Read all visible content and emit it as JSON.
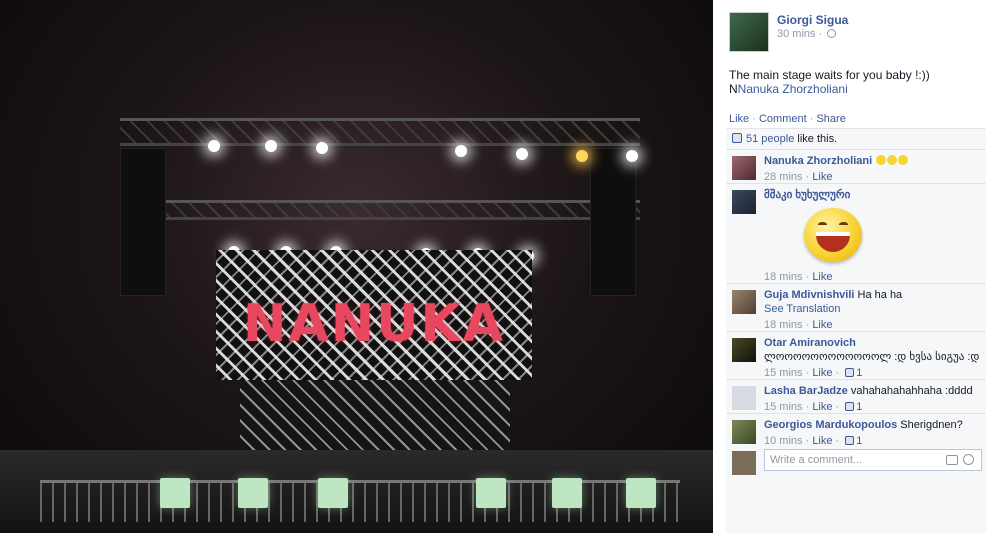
{
  "photo": {
    "stage_text": "NANUKA"
  },
  "post": {
    "author": "Giorgi Sigua",
    "avatar_caption": "",
    "time": "30 mins ·",
    "caption_line1": "The main stage waits for you baby !:))",
    "caption_prefix": "N",
    "caption_tag": "Nanuka Zhorzholiani",
    "actions": {
      "like": "Like",
      "comment": "Comment",
      "share": "Share",
      "sep": "·"
    },
    "likes_count": "51 people",
    "likes_suffix": "like this."
  },
  "comments": [
    {
      "name": "Nanuka Zhorzholiani",
      "text": "",
      "has_emojis": true,
      "time": "28 mins",
      "action": "Like",
      "likes": ""
    },
    {
      "name": "მშაკი ხუხულური",
      "text": "",
      "has_sticker": true,
      "time": "18 mins",
      "action": "Like",
      "likes": ""
    },
    {
      "name": "Guja Mdivnishvili",
      "text": "Ha ha ha",
      "translation": "See Translation",
      "time": "18 mins",
      "action": "Like",
      "likes": ""
    },
    {
      "name": "Otar Amiranovich",
      "text": "ლოოოოოოოოოოოოლ :დ ხვსა სიგუა :დ",
      "time": "15 mins",
      "action": "Like",
      "likes": "1"
    },
    {
      "name": "Lasha BarJadze",
      "text": "vahahahahahhaha :dddd",
      "time": "15 mins",
      "action": "Like",
      "likes": "1"
    },
    {
      "name": "Georgios Mardukopoulos",
      "text": "Sherigdnen?",
      "time": "10 mins",
      "action": "Like",
      "likes": "1"
    }
  ],
  "composer": {
    "placeholder": "Write a comment..."
  },
  "icons": {
    "globe": "globe-icon",
    "thumb": "thumbs-up-icon",
    "camera": "camera-icon",
    "emoji": "emoticon-icon"
  },
  "colors": {
    "link": "#3b5998",
    "meta": "#9197a3",
    "ufi_bg": "#f6f7f9",
    "stage_text": "#e8485f"
  }
}
